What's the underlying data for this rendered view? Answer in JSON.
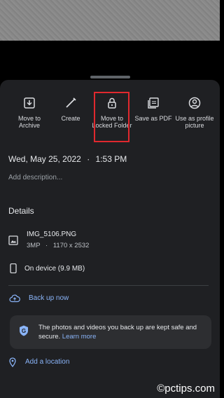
{
  "actions": [
    {
      "label": "Move to Archive",
      "icon": "archive-icon"
    },
    {
      "label": "Create",
      "icon": "create-wand-icon"
    },
    {
      "label": "Move to Locked Folder",
      "icon": "lock-icon"
    },
    {
      "label": "Save as PDF",
      "icon": "pdf-icon"
    },
    {
      "label": "Use as profile picture",
      "icon": "account-circle-icon"
    }
  ],
  "info": {
    "date": "Wed, May 25, 2022",
    "separator": "·",
    "time": "1:53 PM",
    "description_placeholder": "Add description...",
    "details_heading": "Details",
    "file_name": "IMG_5106.PNG",
    "megapixels": "3MP",
    "dimensions": "1170 x 2532",
    "storage": "On device (9.9 MB)"
  },
  "backup": {
    "label": "Back up now",
    "message": "The photos and videos you back up are kept safe and secure.",
    "learn_more": "Learn more"
  },
  "location": {
    "label": "Add a location"
  },
  "watermark": "©pctips.com",
  "colors": {
    "sheet": "#1f2023",
    "accent": "#8ab4f8",
    "highlight": "#e0282e"
  }
}
